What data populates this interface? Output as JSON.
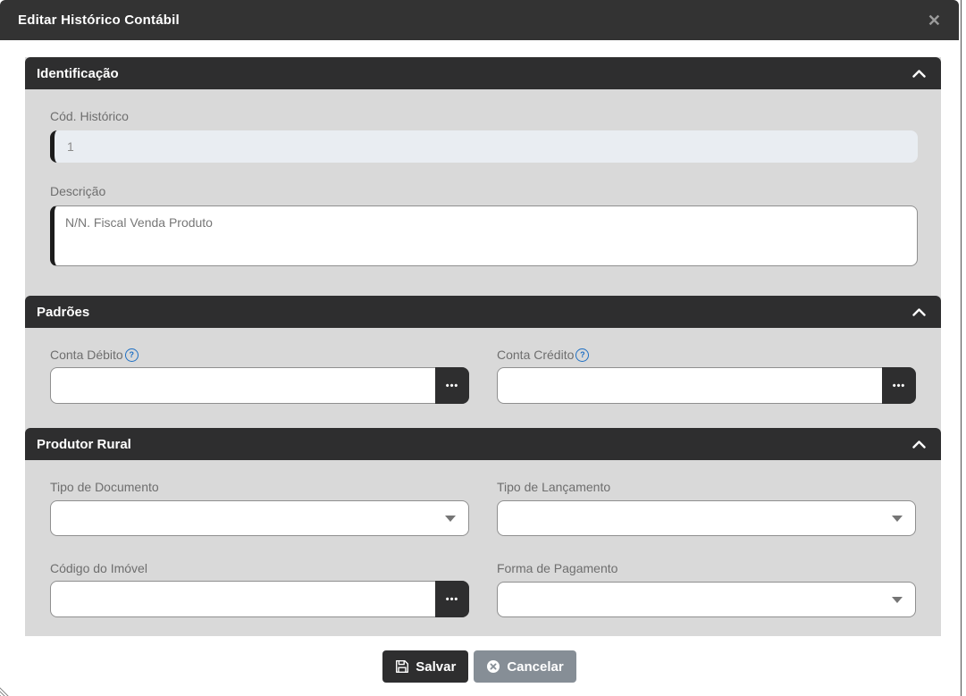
{
  "modal": {
    "title": "Editar Histórico Contábil",
    "close_icon": "✕"
  },
  "sections": {
    "identificacao": {
      "title": "Identificação"
    },
    "padroes": {
      "title": "Padrões"
    },
    "produtor_rural": {
      "title": "Produtor Rural"
    }
  },
  "fields": {
    "cod_historico": {
      "label": "Cód. Histórico",
      "value": "1"
    },
    "descricao": {
      "label": "Descrição",
      "value": "N/N. Fiscal Venda Produto"
    },
    "conta_debito": {
      "label": "Conta Débito",
      "value": ""
    },
    "conta_credito": {
      "label": "Conta Crédito",
      "value": ""
    },
    "tipo_documento": {
      "label": "Tipo de Documento",
      "value": ""
    },
    "tipo_lancamento": {
      "label": "Tipo de Lançamento",
      "value": ""
    },
    "codigo_imovel": {
      "label": "Código do Imóvel",
      "value": ""
    },
    "forma_pagamento": {
      "label": "Forma de Pagamento",
      "value": ""
    }
  },
  "icons": {
    "ellipsis": "•••",
    "help": "?"
  },
  "footer": {
    "save_label": "Salvar",
    "cancel_label": "Cancelar"
  },
  "colors": {
    "header_bar": "#333333",
    "section_bar": "#2e2e2f",
    "panel_background": "#d9d9d9",
    "readonly_field_background": "#e9edf2",
    "field_accent_border": "#1c1c1c",
    "help_icon_blue": "#1e6fc4",
    "save_button": "#2e2e2f",
    "cancel_button": "#868e96"
  }
}
